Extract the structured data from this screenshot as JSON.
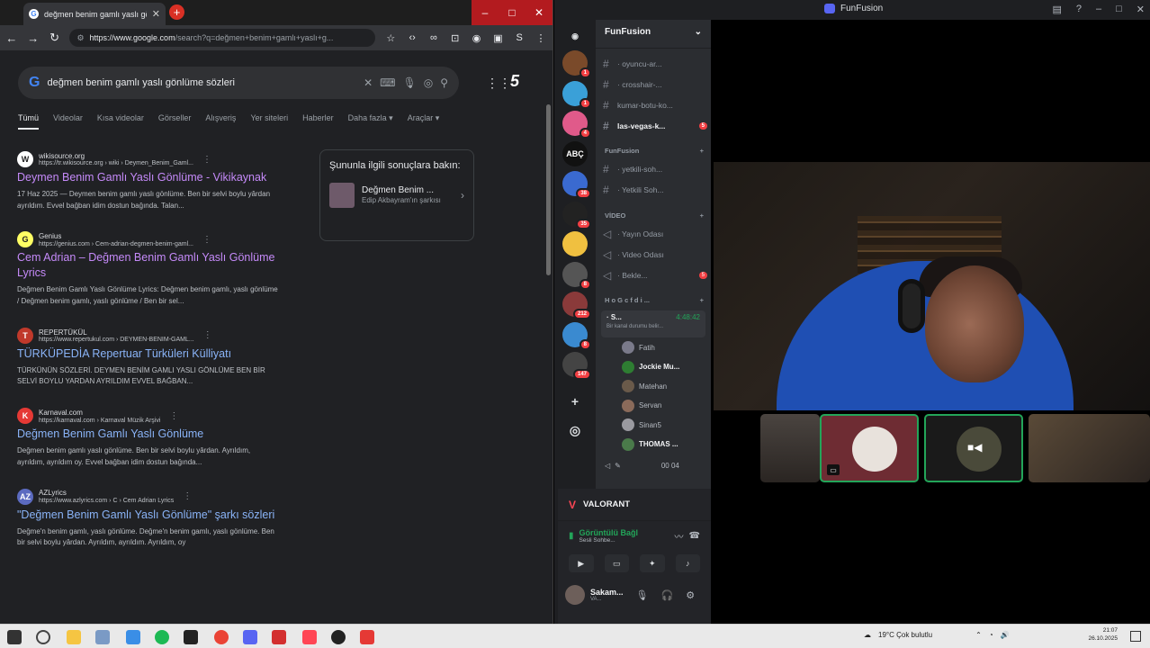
{
  "chrome": {
    "tab_title": "değmen benim gamlı yaslı göı",
    "url_domain": "https://www.google.com",
    "url_path": "/search?q=değmen+benim+gamlı+yaslı+g...",
    "search_query": "değmen benim gamlı yaslı gönlüme sözleri",
    "search_tabs": [
      "Tümü",
      "Videolar",
      "Kısa videolar",
      "Görseller",
      "Alışveriş",
      "Yer siteleri",
      "Haberler",
      "Daha fazla ▾",
      "Araçlar ▾"
    ],
    "results": [
      {
        "site": "wikisource.org",
        "url": "https://tr.wikisource.org › wiki › Deymen_Benim_Gaml...",
        "title": "Deymen Benim Gamlı Yaslı Gönlüme - Vikikaynak",
        "snippet": "17 Haz 2025 — Deymen benim gamlı yaslı gönlüme. Ben bir selvi boylu yârdan ayrıldım. Evvel bağban idim dostun bağında. Talan...",
        "visited": true,
        "fav_color": "#ffffff",
        "fav_text": "W"
      },
      {
        "site": "Genius",
        "url": "https://genius.com › Cem-adrian-degmen-benim-gaml...",
        "title": "Cem Adrian – Değmen Benim Gamlı Yaslı Gönlüme Lyrics",
        "snippet": "Değmen Benim Gamlı Yaslı Gönlüme Lyrics: Değmen benim gamlı, yaslı gönlüme / Değmen benim gamlı, yaslı gönlüme / Ben bir sel...",
        "visited": true,
        "fav_color": "#ffff64",
        "fav_text": "G"
      },
      {
        "site": "REPERTÜKÜL",
        "url": "https://www.repertukul.com › DEYMEN-BENIM-GAML...",
        "title": "TÜRKÜPEDİA Repertuar Türküleri Külliyatı",
        "snippet": "TÜRKÜNÜN SÖZLERİ. DEYMEN BENİM GAMLI YASLI GÖNLÜME BEN BİR SELVİ BOYLU YARDAN AYRILDIM EVVEL BAĞBAN...",
        "visited": false,
        "fav_color": "#c0392b",
        "fav_text": "T"
      },
      {
        "site": "Karnaval.com",
        "url": "https://karnaval.com › Karnaval Müzik Arşivi",
        "title": "Değmen Benim Gamlı Yaslı Gönlüme",
        "snippet": "Değmen benim gamlı yaslı gönlüme. Ben bir selvi boylu yârdan. Ayrıldım, ayrıldım, ayrıldım oy. Evvel bağban idim dostun bağında...",
        "visited": false,
        "fav_color": "#e53935",
        "fav_text": "K"
      },
      {
        "site": "AZLyrics",
        "url": "https://www.azlyrics.com › C › Cem Adrian Lyrics",
        "title": "\"Değmen Benim Gamlı Yaslı Gönlüme\" şarkı sözleri",
        "snippet": "Değme'n benim gamlı, yaslı gönlüme. Değme'n benim gamlı, yaslı gönlüme. Ben bir selvi boylu yârdan. Ayrıldım, ayrıldım. Ayrıldım, oy",
        "visited": false,
        "fav_color": "#5c6bc0",
        "fav_text": "AZ"
      }
    ],
    "knowledge": {
      "heading": "Şununla ilgili sonuçlara bakın:",
      "item_name": "Değmen Benim ...",
      "item_sub": "Edip Akbayram'ın şarkısı"
    }
  },
  "discord": {
    "window_title": "FunFusion",
    "server_name": "FunFusion",
    "channels": [
      {
        "name": "· oyuncu-ar...",
        "unread": false,
        "badge": ""
      },
      {
        "name": "· crosshair-...",
        "unread": false,
        "badge": ""
      },
      {
        "name": "kumar-botu-ko...",
        "unread": false,
        "badge": ""
      },
      {
        "name": "las-vegas-k...",
        "unread": true,
        "badge": "5"
      }
    ],
    "cat1": "FunFusion",
    "cat1_channels": [
      "· yetkili-soh...",
      "· Yetkili Soh..."
    ],
    "cat2": "VİDEO",
    "cat2_channels": [
      {
        "name": "· Yayın Odası",
        "badge": ""
      },
      {
        "name": "· Video Odası",
        "badge": ""
      },
      {
        "name": "· Bekle...",
        "badge": "5"
      }
    ],
    "cat3": "H o G c f d i ...",
    "active_vc": "· S...",
    "active_vc_time": "4:48:42",
    "active_vc_sub": "Bir kanal durumu belir...",
    "voice_users": [
      "Fatih",
      "Jockie Mu...",
      "Matehan",
      "Servan",
      "Sinan5",
      "THOMAS ..."
    ],
    "voice_user_bright": [
      false,
      true,
      false,
      false,
      false,
      true
    ],
    "voice_extra": "00 04",
    "game": "VALORANT",
    "conn_status": "Görüntülü Bağl",
    "conn_sub": "Sesli Sohbe...",
    "user_name": "Sakam...",
    "user_sub": "VA...",
    "guild_badges": [
      "1",
      "1",
      "4",
      "",
      "38",
      "35",
      "",
      "8",
      "212",
      "8",
      "147"
    ]
  },
  "taskbar": {
    "weather": "19°C  Çok bulutlu",
    "time": "21:07",
    "date": "26.10.2025"
  }
}
